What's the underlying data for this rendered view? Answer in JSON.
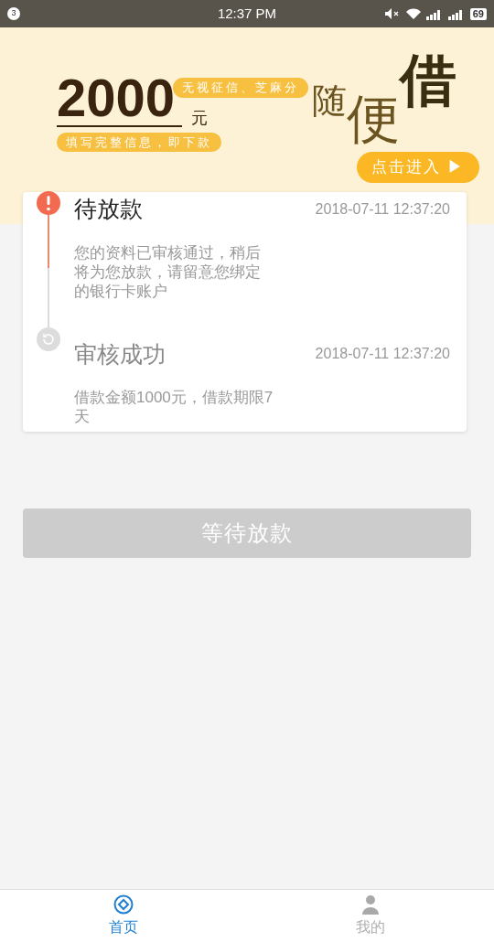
{
  "status_bar": {
    "notification_count": "3",
    "time": "12:37 PM",
    "battery": "69"
  },
  "banner": {
    "amount": "2000",
    "unit": "元",
    "tag_top": "无视征信、芝麻分",
    "tag_bottom": "填写完整信息，即下款",
    "slogan_1": "随",
    "slogan_2": "便",
    "slogan_3": "借",
    "cta": "点击进入 ▶"
  },
  "timeline": [
    {
      "kind": "alert",
      "active": true,
      "title": "待放款",
      "time": "2018-07-11 12:37:20",
      "description": "您的资料已审核通过，稍后将为您放款，请留意您绑定的银行卡账户"
    },
    {
      "kind": "done",
      "active": false,
      "title": "审核成功",
      "time": "2018-07-11 12:37:20",
      "description": "借款金额1000元，借款期限7天"
    }
  ],
  "action_button": {
    "label": "等待放款",
    "disabled": true
  },
  "tab_bar": [
    {
      "label": "首页",
      "kind": "home",
      "selected": true
    },
    {
      "label": "我的",
      "kind": "profile",
      "selected": false
    }
  ]
}
